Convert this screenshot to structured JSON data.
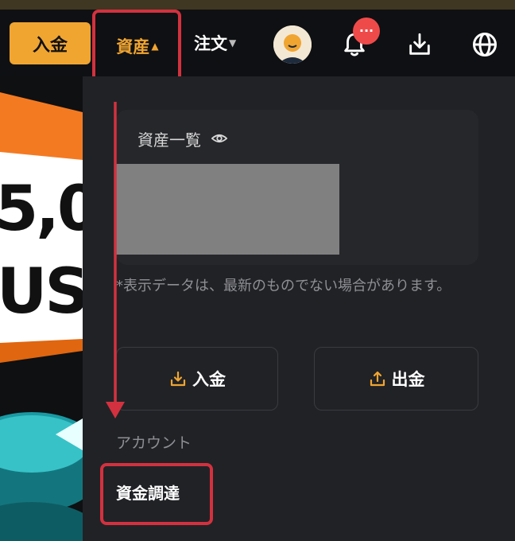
{
  "nav": {
    "deposit_label": "入金",
    "assets_label": "資産",
    "assets_caret": "▲",
    "orders_label": "注文",
    "orders_caret": "▼",
    "notification_badge": "···"
  },
  "dropdown": {
    "summary_title": "資産一覧",
    "disclaimer": "*表示データは、最新のものでない場合があります。",
    "deposit_label": "入金",
    "withdraw_label": "出金",
    "section_label": "アカウント",
    "funding_label": "資金調達"
  },
  "banner": {
    "amount_fragment": "5,0",
    "unit_fragment": "US"
  },
  "colors": {
    "accent": "#f0a531",
    "highlight": "#d3313f",
    "panel": "#212226",
    "navbar": "#0f1013"
  }
}
